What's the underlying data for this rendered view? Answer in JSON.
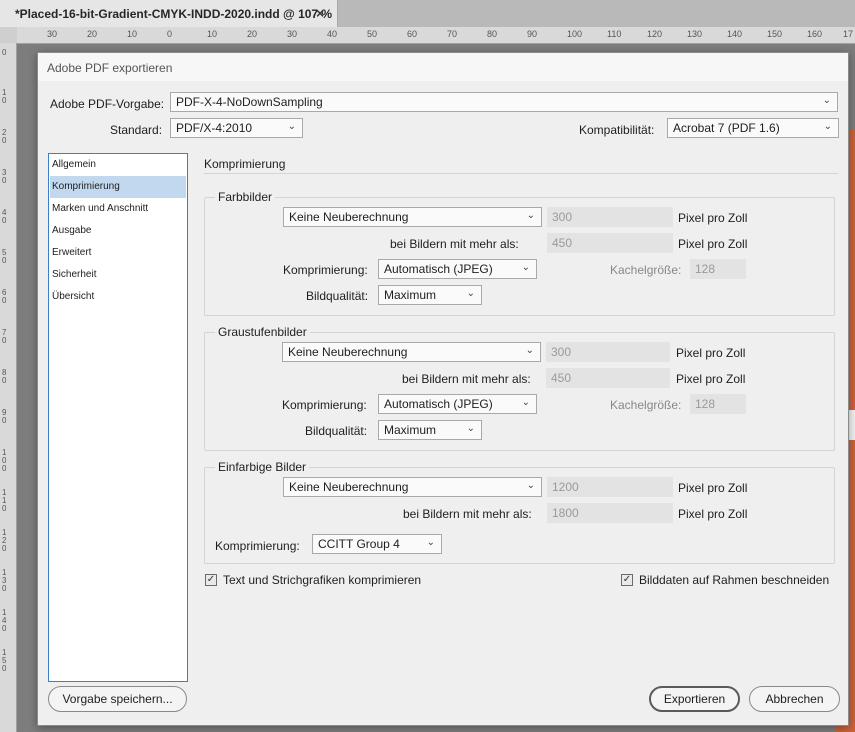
{
  "document_tab": {
    "title": "*Placed-16-bit-Gradient-CMYK-INDD-2020.indd @ 107 %",
    "close": "×"
  },
  "ruler_top": [
    "30",
    "20",
    "10",
    "0",
    "10",
    "20",
    "30",
    "40",
    "50",
    "60",
    "70",
    "80",
    "90",
    "100",
    "110",
    "120",
    "130",
    "140",
    "150",
    "160",
    "17"
  ],
  "ruler_left": [
    "0",
    "1\n0",
    "2\n0",
    "3\n0",
    "4\n0",
    "5\n0",
    "6\n0",
    "7\n0",
    "8\n0",
    "9\n0",
    "1\n0\n0",
    "1\n1\n0",
    "1\n2\n0",
    "1\n3\n0",
    "1\n4\n0",
    "1\n5\n0"
  ],
  "dialog": {
    "title": "Adobe PDF exportieren",
    "preset_label": "Adobe PDF-Vorgabe:",
    "preset_value": "PDF-X-4-NoDownSampling",
    "standard_label": "Standard:",
    "standard_value": "PDF/X-4:2010",
    "compat_label": "Kompatibilität:",
    "compat_value": "Acrobat 7 (PDF 1.6)",
    "sidebar": [
      "Allgemein",
      "Komprimierung",
      "Marken und Anschnitt",
      "Ausgabe",
      "Erweitert",
      "Sicherheit",
      "Übersicht"
    ],
    "section_title": "Komprimierung",
    "color": {
      "title": "Farbbilder",
      "resample": "Keine Neuberechnung",
      "ppi": "300",
      "ppi_unit": "Pixel pro Zoll",
      "above_label": "bei Bildern mit mehr als:",
      "above_value": "450",
      "above_unit": "Pixel pro Zoll",
      "compression_label": "Komprimierung:",
      "compression_value": "Automatisch (JPEG)",
      "tile_label": "Kachelgröße:",
      "tile_value": "128",
      "quality_label": "Bildqualität:",
      "quality_value": "Maximum"
    },
    "gray": {
      "title": "Graustufenbilder",
      "resample": "Keine Neuberechnung",
      "ppi": "300",
      "ppi_unit": "Pixel pro Zoll",
      "above_label": "bei Bildern mit mehr als:",
      "above_value": "450",
      "above_unit": "Pixel pro Zoll",
      "compression_label": "Komprimierung:",
      "compression_value": "Automatisch (JPEG)",
      "tile_label": "Kachelgröße:",
      "tile_value": "128",
      "quality_label": "Bildqualität:",
      "quality_value": "Maximum"
    },
    "mono": {
      "title": "Einfarbige Bilder",
      "resample": "Keine Neuberechnung",
      "ppi": "1200",
      "ppi_unit": "Pixel pro Zoll",
      "above_label": "bei Bildern mit mehr als:",
      "above_value": "1800",
      "above_unit": "Pixel pro Zoll",
      "compression_label": "Komprimierung:",
      "compression_value": "CCITT Group 4"
    },
    "compress_text_label": "Text und Strichgrafiken komprimieren",
    "crop_label": "Bilddaten auf Rahmen beschneiden",
    "save_preset": "Vorgabe speichern...",
    "export": "Exportieren",
    "cancel": "Abbrechen"
  }
}
